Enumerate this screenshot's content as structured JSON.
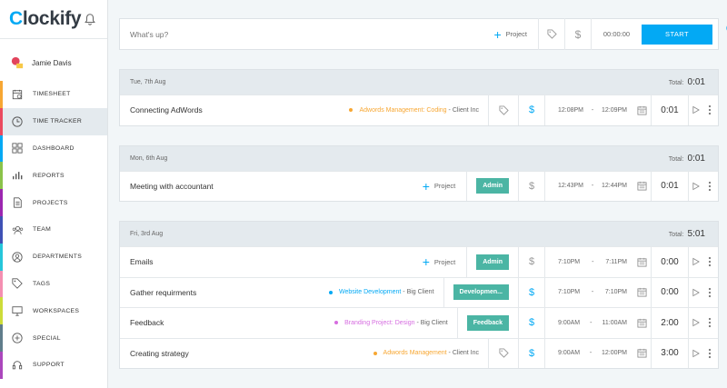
{
  "app": {
    "logo_first": "C",
    "logo_rest": "lockify"
  },
  "user": {
    "name": "Jamie Davis"
  },
  "nav": [
    {
      "label": "TIMESHEET",
      "icon": "timesheet-icon",
      "color": "#f7a733"
    },
    {
      "label": "TIME TRACKER",
      "icon": "clock-icon",
      "color": "#eb4a5f",
      "active": true
    },
    {
      "label": "DASHBOARD",
      "icon": "dashboard-icon",
      "color": "#03a9f4"
    },
    {
      "label": "REPORTS",
      "icon": "reports-icon",
      "color": "#8bc34a"
    },
    {
      "label": "PROJECTS",
      "icon": "projects-icon",
      "color": "#9c27b0"
    },
    {
      "label": "TEAM",
      "icon": "team-icon",
      "color": "#3f51b5"
    },
    {
      "label": "DEPARTMENTS",
      "icon": "departments-icon",
      "color": "#26c6da"
    },
    {
      "label": "TAGS",
      "icon": "tag-icon",
      "color": "#f48fb1"
    },
    {
      "label": "WORKSPACES",
      "icon": "workspaces-icon",
      "color": "#cddc39"
    },
    {
      "label": "SPECIAL",
      "icon": "plus-circle-icon",
      "color": "#607d8b"
    },
    {
      "label": "SUPPORT",
      "icon": "support-icon",
      "color": "#ab47bc"
    }
  ],
  "timer": {
    "placeholder": "What's up?",
    "project_label": "Project",
    "time": "00:00:00",
    "start_label": "START"
  },
  "days": [
    {
      "date": "Tue, 7th Aug",
      "total_label": "Total:",
      "total": "0:01",
      "entries": [
        {
          "desc": "Connecting AdWords",
          "project": "Adwords Management: Coding",
          "client": "Client Inc",
          "project_color": "#f7a733",
          "tag": null,
          "billable": true,
          "start": "12:08PM",
          "end": "12:09PM",
          "duration": "0:01"
        }
      ]
    },
    {
      "date": "Mon, 6th Aug",
      "total_label": "Total:",
      "total": "0:01",
      "entries": [
        {
          "desc": "Meeting with accountant",
          "project": null,
          "add_project_label": "Project",
          "tag": "Admin",
          "billable": false,
          "start": "12:43PM",
          "end": "12:44PM",
          "duration": "0:01"
        }
      ]
    },
    {
      "date": "Fri, 3rd Aug",
      "total_label": "Total:",
      "total": "5:01",
      "entries": [
        {
          "desc": "Emails",
          "project": null,
          "add_project_label": "Project",
          "tag": "Admin",
          "billable": false,
          "start": "7:10PM",
          "end": "7:11PM",
          "duration": "0:00"
        },
        {
          "desc": "Gather requirments",
          "project": "Website Development",
          "client": "Big Client",
          "project_color": "#03a9f4",
          "tag": "Developmen...",
          "billable": true,
          "start": "7:10PM",
          "end": "7:10PM",
          "duration": "0:00"
        },
        {
          "desc": "Feedback",
          "project": "Branding Project: Design",
          "client": "Big Client",
          "project_color": "#d66de0",
          "tag": "Feedback",
          "billable": true,
          "start": "9:00AM",
          "end": "11:00AM",
          "duration": "2:00"
        },
        {
          "desc": "Creating strategy",
          "project": "Adwords Management",
          "client": "Client Inc",
          "project_color": "#f7a733",
          "tag": null,
          "billable": true,
          "start": "9:00AM",
          "end": "12:00PM",
          "duration": "3:00"
        }
      ]
    }
  ]
}
